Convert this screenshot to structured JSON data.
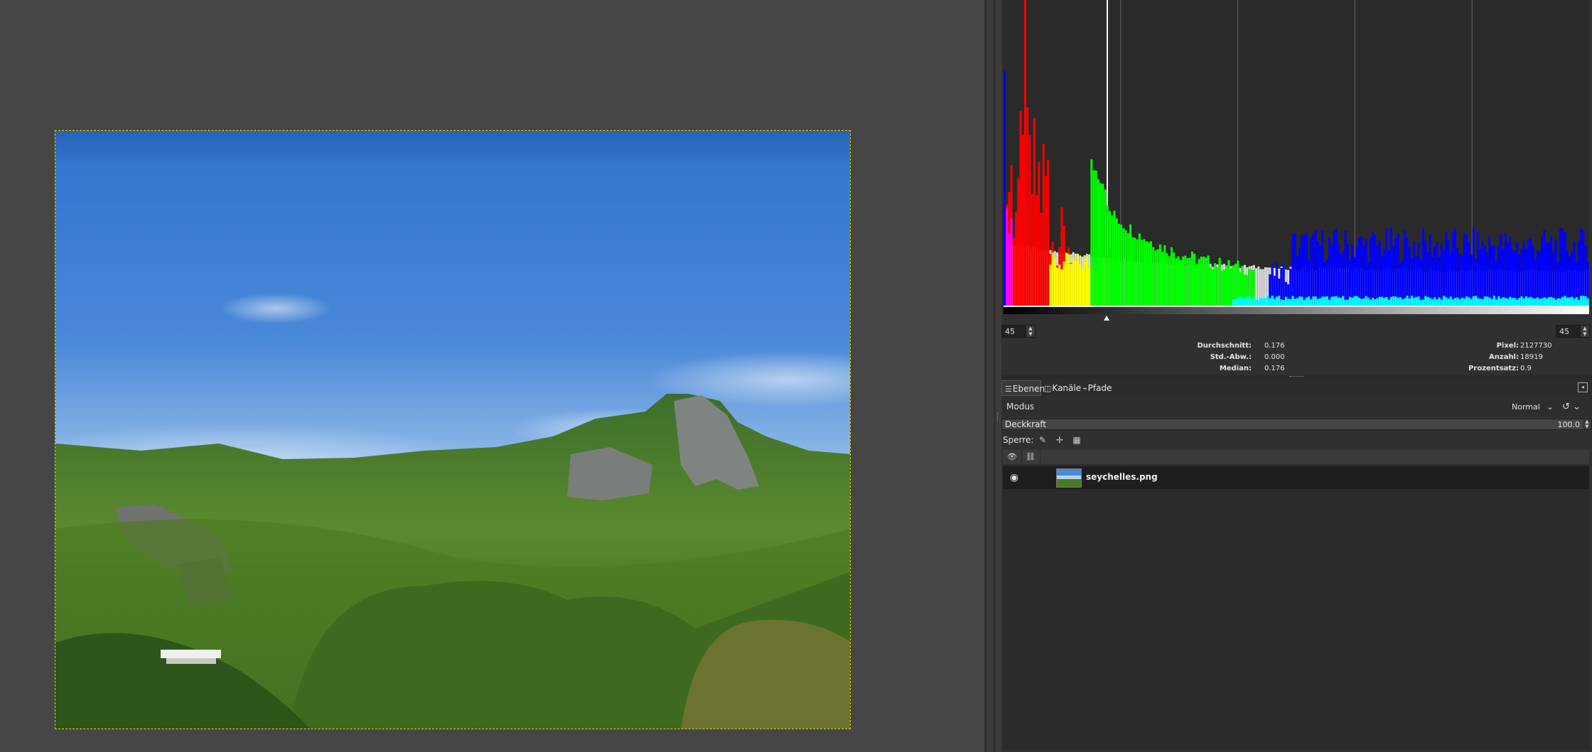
{
  "canvas": {
    "image_name": "seychelles.png"
  },
  "histogram": {
    "range_low": "45",
    "range_high": "45",
    "stats_left": [
      {
        "label": "Durchschnitt:",
        "value": "0.176"
      },
      {
        "label": "Std.-Abw.:",
        "value": "0.000"
      },
      {
        "label": "Median:",
        "value": "0.176"
      }
    ],
    "stats_right": [
      {
        "label": "Pixel:",
        "value": "2127730"
      },
      {
        "label": "Anzahl:",
        "value": "18919"
      },
      {
        "label": "Prozentsatz:",
        "value": "0.9"
      }
    ],
    "colors": {
      "red": "#ff0000",
      "green": "#00ff00",
      "blue": "#0000ff",
      "yellow": "#ffff00",
      "cyan": "#00ffff",
      "magenta": "#ff00ff",
      "gray": "#d9d9d9"
    }
  },
  "dock": {
    "tabs": [
      {
        "label": "Ebenen",
        "icon": "layers-icon"
      },
      {
        "label": "Kanäle",
        "icon": "channels-icon"
      },
      {
        "label": "Pfade",
        "icon": "paths-icon"
      }
    ],
    "mode_label": "Modus",
    "mode_value": "Normal",
    "opacity_label": "Deckkraft",
    "opacity_value": "100.0",
    "lock_label": "Sperre:",
    "layers": [
      {
        "name": "seychelles.png",
        "visible": true
      }
    ]
  }
}
